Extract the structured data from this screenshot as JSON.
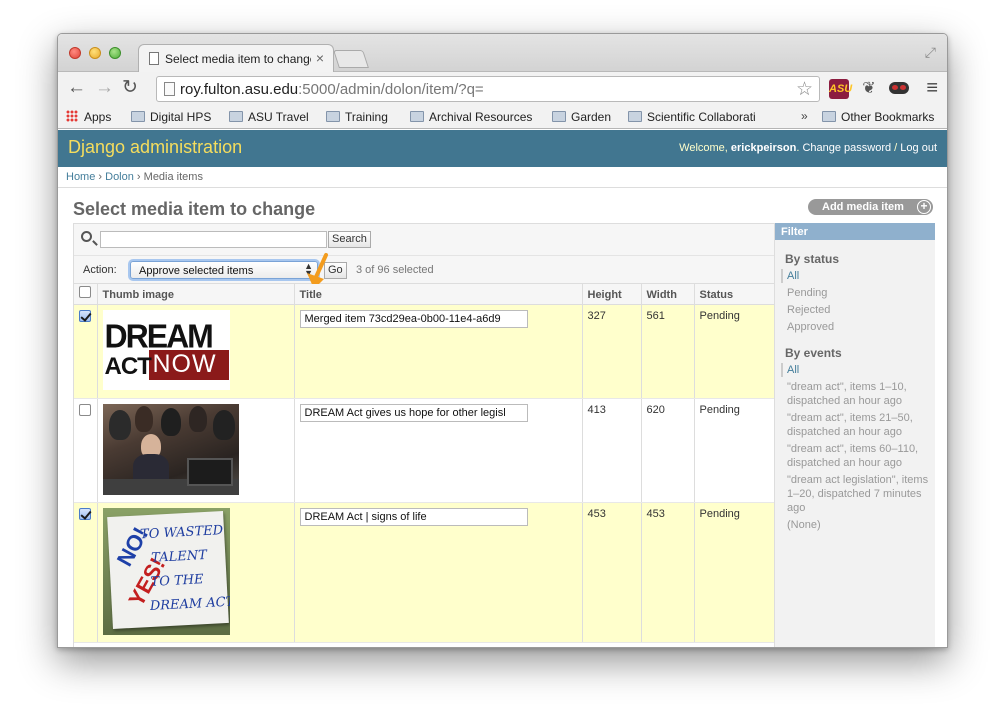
{
  "browser": {
    "tab_title": "Select media item to change",
    "tab_close": "×",
    "url_host": "roy.fulton.asu.edu",
    "url_rest": ":5000/admin/dolon/item/?q=",
    "bookmarks": [
      "Apps",
      "Digital HPS",
      "ASU Travel",
      "Training",
      "Archival Resources",
      "Garden",
      "Scientific Collaborati",
      "Other Bookmarks"
    ],
    "bookmark_chevron": "»",
    "extension_asu": "ASU"
  },
  "header": {
    "brand": "Django administration",
    "welcome": "Welcome, ",
    "username": "erickpeirson",
    "change_password": "Change password",
    "separator": " / ",
    "logout": "Log out"
  },
  "breadcrumbs": {
    "home": "Home",
    "app": "Dolon",
    "sep": " › ",
    "current": "Media items"
  },
  "page_title": "Select media item to change",
  "add_button": "Add media item",
  "search": {
    "value": "",
    "button": "Search"
  },
  "actions": {
    "label": "Action:",
    "selected": "Approve selected items",
    "go": "Go",
    "counter": "3 of 96 selected"
  },
  "table": {
    "headers": [
      "Thumb image",
      "Title",
      "Height",
      "Width",
      "Status"
    ],
    "rows": [
      {
        "checked": true,
        "title": "Merged item 73cd29ea-0b00-11e4-a6d9",
        "height": "327",
        "width": "561",
        "status": "Pending"
      },
      {
        "checked": false,
        "title": "DREAM Act gives us hope for other legisl",
        "height": "413",
        "width": "620",
        "status": "Pending"
      },
      {
        "checked": true,
        "title": "DREAM Act | signs of life",
        "height": "453",
        "width": "453",
        "status": "Pending"
      }
    ]
  },
  "thumb_text": {
    "row1": {
      "line1": "DREAM",
      "line2": "ACT",
      "line3": "NOW"
    },
    "row3": {
      "no": "NO!",
      "yes": "YES!",
      "l1": "TO WASTED",
      "l2": "TALENT",
      "l3": "TO THE",
      "l4": "DREAM ACT"
    }
  },
  "filter": {
    "title": "Filter",
    "by_status": "By status",
    "status_items": [
      "All",
      "Pending",
      "Rejected",
      "Approved"
    ],
    "by_events": "By events",
    "event_items": [
      "All",
      "\"dream act\", items 1–10, dispatched an hour ago",
      "\"dream act\", items 21–50, dispatched an hour ago",
      "\"dream act\", items 60–110, dispatched an hour ago",
      "\"dream act legislation\", items 1–20, dispatched 7 minutes ago",
      "(None)"
    ]
  },
  "colors": {
    "header_bg": "#417690",
    "brand": "#f5dd5d",
    "selected_row": "#ffffcc",
    "annotation_arrow": "#f39c1e"
  }
}
